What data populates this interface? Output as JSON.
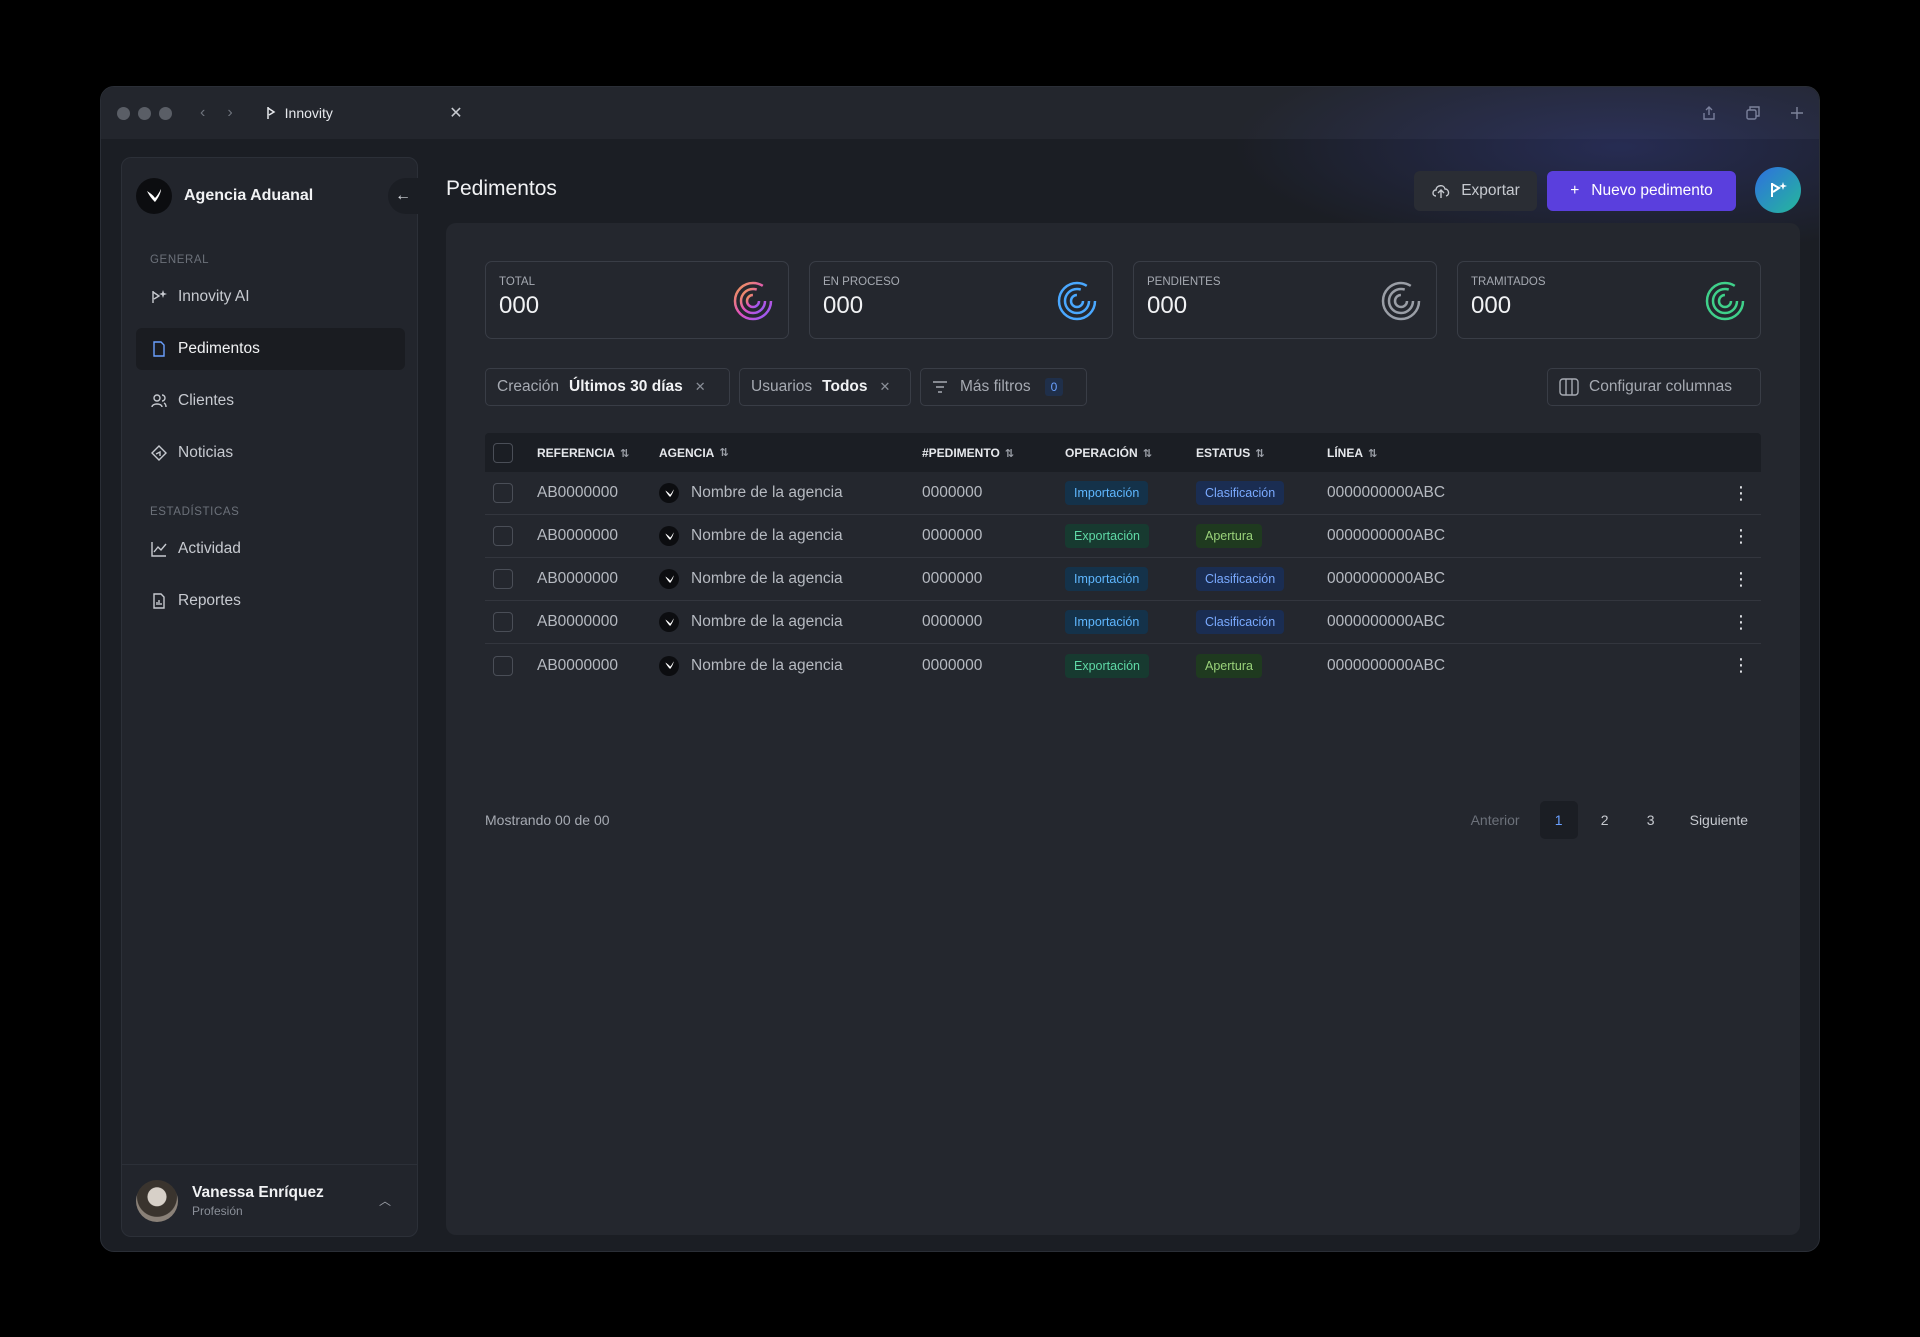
{
  "browser": {
    "tab_title": "Innovity"
  },
  "sidebar": {
    "brand": "Agencia Aduanal",
    "sections": [
      {
        "title": "General",
        "items": [
          {
            "label": "Innovity AI",
            "icon": "ai-sparkle-icon"
          },
          {
            "label": "Pedimentos",
            "icon": "document-icon",
            "active": true
          },
          {
            "label": "Clientes",
            "icon": "users-icon"
          },
          {
            "label": "Noticias",
            "icon": "news-icon"
          }
        ]
      },
      {
        "title": "Estadísticas",
        "items": [
          {
            "label": "Actividad",
            "icon": "chart-line-icon"
          },
          {
            "label": "Reportes",
            "icon": "report-icon"
          }
        ]
      }
    ],
    "user": {
      "name": "Vanessa Enríquez",
      "role": "Profesión"
    }
  },
  "header": {
    "title": "Pedimentos",
    "export_label": "Exportar",
    "new_label": "Nuevo pedimento"
  },
  "stats": [
    {
      "label": "Total",
      "value": "000",
      "color": "#c36bff"
    },
    {
      "label": "En proceso",
      "value": "000",
      "color": "#4aa8ff"
    },
    {
      "label": "Pendientes",
      "value": "000",
      "color": "#9a9ea6"
    },
    {
      "label": "Tramitados",
      "value": "000",
      "color": "#3fd08a"
    }
  ],
  "filters": {
    "creation_label": "Creación",
    "creation_value": "Últimos 30 días",
    "users_label": "Usuarios",
    "users_value": "Todos",
    "more_label": "Más filtros",
    "more_count": "0",
    "columns_label": "Configurar columnas"
  },
  "table": {
    "columns": [
      "Referencia",
      "Agencia",
      "#Pedimento",
      "Operación",
      "Estatus",
      "Línea"
    ],
    "rows": [
      {
        "ref": "AB0000000",
        "agency": "Nombre de la agencia",
        "num": "0000000",
        "op": "Importación",
        "status": "Clasificación",
        "line": "0000000000ABC"
      },
      {
        "ref": "AB0000000",
        "agency": "Nombre de la agencia",
        "num": "0000000",
        "op": "Exportación",
        "status": "Apertura",
        "line": "0000000000ABC"
      },
      {
        "ref": "AB0000000",
        "agency": "Nombre de la agencia",
        "num": "0000000",
        "op": "Importación",
        "status": "Clasificación",
        "line": "0000000000ABC"
      },
      {
        "ref": "AB0000000",
        "agency": "Nombre de la agencia",
        "num": "0000000",
        "op": "Importación",
        "status": "Clasificación",
        "line": "0000000000ABC"
      },
      {
        "ref": "AB0000000",
        "agency": "Nombre de la agencia",
        "num": "0000000",
        "op": "Exportación",
        "status": "Apertura",
        "line": "0000000000ABC"
      }
    ]
  },
  "pagination": {
    "summary": "Mostrando 00 de 00",
    "prev": "Anterior",
    "pages": [
      "1",
      "2",
      "3"
    ],
    "current": "1",
    "next": "Siguiente"
  }
}
